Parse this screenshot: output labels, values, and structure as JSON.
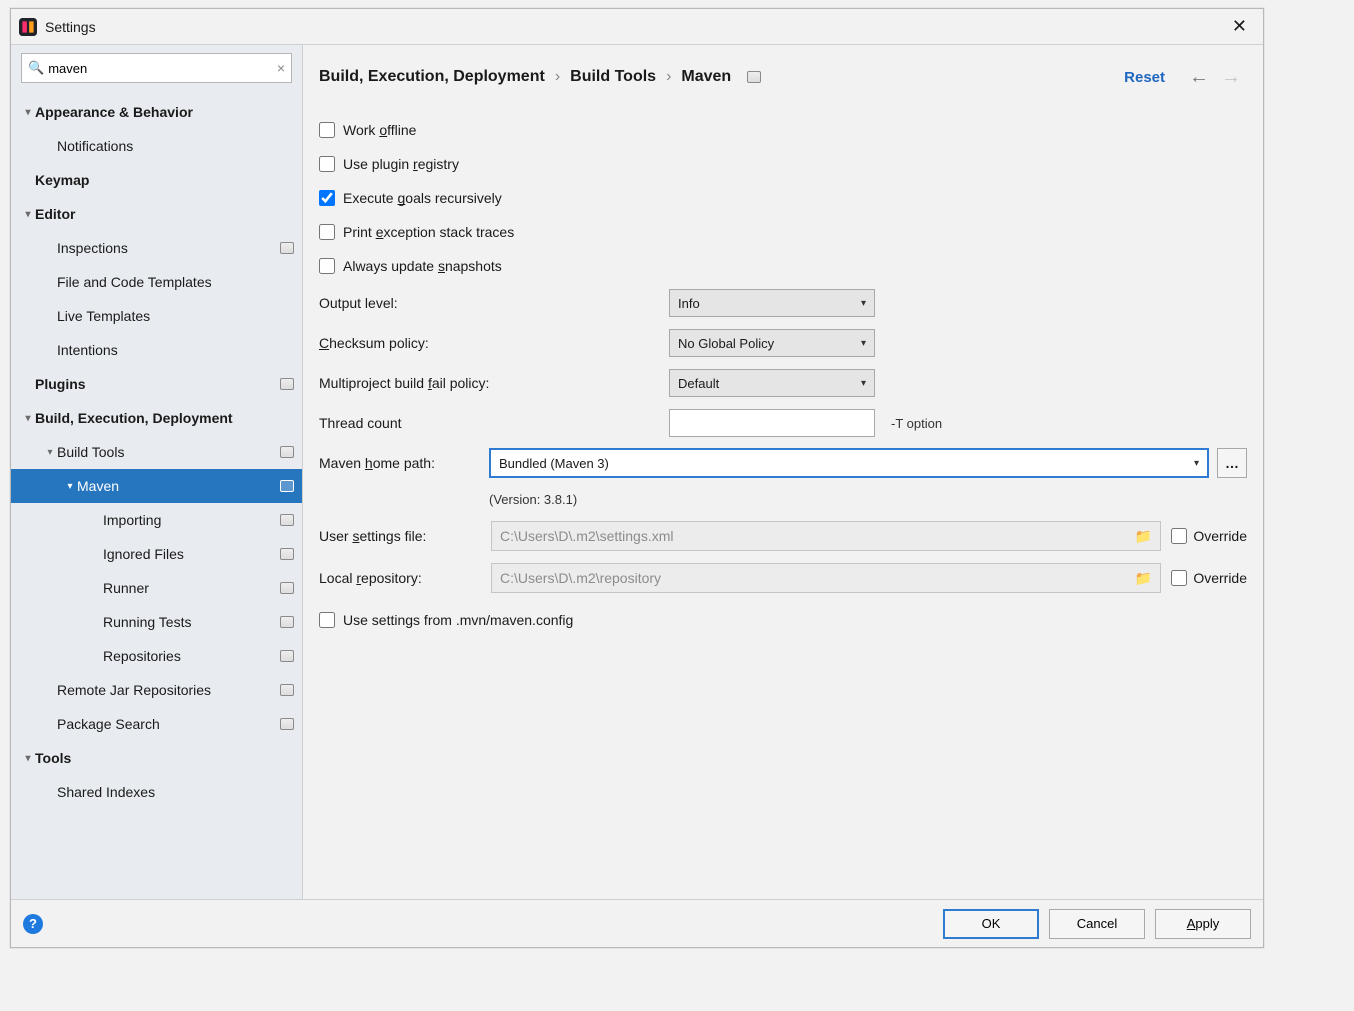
{
  "window": {
    "title": "Settings"
  },
  "search": {
    "value": "maven"
  },
  "sidebar": {
    "appearance": "Appearance & Behavior",
    "notifications": "Notifications",
    "keymap": "Keymap",
    "editor": "Editor",
    "inspections": "Inspections",
    "file_templates": "File and Code Templates",
    "live_templates": "Live Templates",
    "intentions": "Intentions",
    "plugins": "Plugins",
    "bed": "Build, Execution, Deployment",
    "build_tools": "Build Tools",
    "maven": "Maven",
    "importing": "Importing",
    "ignored_files": "Ignored Files",
    "runner": "Runner",
    "running_tests": "Running Tests",
    "repositories": "Repositories",
    "remote_jar": "Remote Jar Repositories",
    "package_search": "Package Search",
    "tools": "Tools",
    "shared_indexes": "Shared Indexes"
  },
  "breadcrumb": {
    "a": "Build, Execution, Deployment",
    "b": "Build Tools",
    "c": "Maven",
    "reset": "Reset"
  },
  "form": {
    "work_offline": "Work offline",
    "use_plugin_registry": "Use plugin registry",
    "execute_recursively": "Execute goals recursively",
    "print_traces": "Print exception stack traces",
    "always_update": "Always update snapshots",
    "output_level_label": "Output level:",
    "output_level_value": "Info",
    "checksum_label": "Checksum policy:",
    "checksum_value": "No Global Policy",
    "fail_label": "Multiproject build fail policy:",
    "fail_value": "Default",
    "thread_label": "Thread count",
    "thread_value": "",
    "thread_hint": "-T option",
    "home_label": "Maven home path:",
    "home_value": "Bundled (Maven 3)",
    "version": "(Version: 3.8.1)",
    "user_settings_label": "User settings file:",
    "user_settings_value": "C:\\Users\\D\\.m2\\settings.xml",
    "local_repo_label": "Local repository:",
    "local_repo_value": "C:\\Users\\D\\.m2\\repository",
    "override": "Override",
    "use_mvn_config": "Use settings from .mvn/maven.config"
  },
  "buttons": {
    "ok": "OK",
    "cancel": "Cancel",
    "apply": "Apply"
  }
}
